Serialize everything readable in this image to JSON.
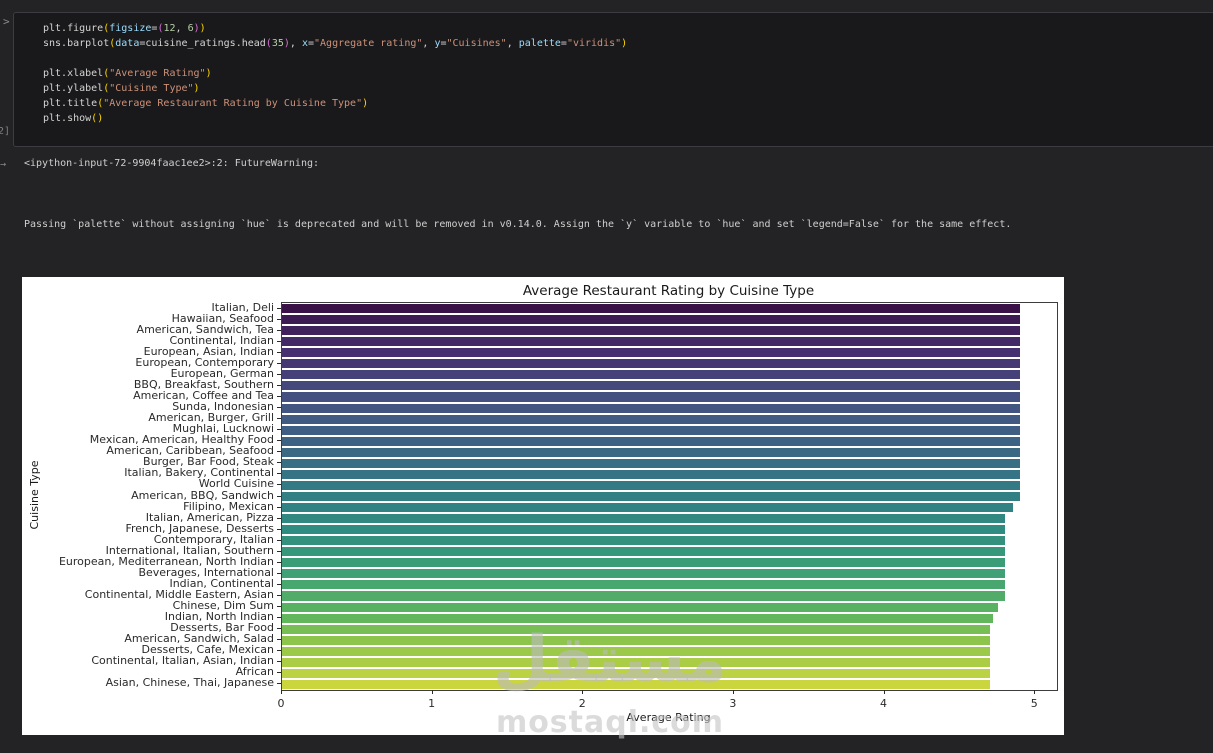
{
  "notebook": {
    "gutter": {
      "collapse_icon": ">",
      "execution_label": "2]",
      "output_marker_icon": "→"
    },
    "cell": {
      "token_colors": {
        "pl": "#d4d4d4",
        "kw": "#9cdcfe",
        "st": "#ce9178",
        "nu": "#b5cea8",
        "b1": "#ffd700",
        "b2": "#da70d6"
      },
      "code_lines": [
        [
          [
            "pl",
            "plt.figure"
          ],
          [
            "b1",
            "("
          ],
          [
            "kw",
            "figsize"
          ],
          [
            "pl",
            "="
          ],
          [
            "b2",
            "("
          ],
          [
            "nu",
            "12"
          ],
          [
            "pl",
            ", "
          ],
          [
            "nu",
            "6"
          ],
          [
            "b2",
            ")"
          ],
          [
            "b1",
            ")"
          ]
        ],
        [
          [
            "pl",
            "sns.barplot"
          ],
          [
            "b1",
            "("
          ],
          [
            "kw",
            "data"
          ],
          [
            "pl",
            "=cuisine_ratings.head"
          ],
          [
            "b2",
            "("
          ],
          [
            "nu",
            "35"
          ],
          [
            "b2",
            ")"
          ],
          [
            "pl",
            ", "
          ],
          [
            "kw",
            "x"
          ],
          [
            "pl",
            "="
          ],
          [
            "st",
            "\"Aggregate rating\""
          ],
          [
            "pl",
            ", "
          ],
          [
            "kw",
            "y"
          ],
          [
            "pl",
            "="
          ],
          [
            "st",
            "\"Cuisines\""
          ],
          [
            "pl",
            ", "
          ],
          [
            "kw",
            "palette"
          ],
          [
            "pl",
            "="
          ],
          [
            "st",
            "\"viridis\""
          ],
          [
            "b1",
            ")"
          ]
        ],
        [],
        [
          [
            "pl",
            "plt.xlabel"
          ],
          [
            "b1",
            "("
          ],
          [
            "st",
            "\"Average Rating\""
          ],
          [
            "b1",
            ")"
          ]
        ],
        [
          [
            "pl",
            "plt.ylabel"
          ],
          [
            "b1",
            "("
          ],
          [
            "st",
            "\"Cuisine Type\""
          ],
          [
            "b1",
            ")"
          ]
        ],
        [
          [
            "pl",
            "plt.title"
          ],
          [
            "b1",
            "("
          ],
          [
            "st",
            "\"Average Restaurant Rating by Cuisine Type\""
          ],
          [
            "b1",
            ")"
          ]
        ],
        [
          [
            "pl",
            "plt.show"
          ],
          [
            "b1",
            "("
          ],
          [
            "b1",
            ")"
          ]
        ]
      ]
    },
    "output": {
      "warning_location": "<ipython-input-72-9904faac1ee2>:2: FutureWarning:",
      "warning_message": "Passing `palette` without assigning `hue` is deprecated and will be removed in v0.14.0. Assign the `y` variable to `hue` and set `legend=False` for the same effect."
    }
  },
  "chart_data": {
    "type": "bar",
    "orientation": "horizontal",
    "title": "Average Restaurant Rating by Cuisine Type",
    "xlabel": "Average Rating",
    "ylabel": "Cuisine Type",
    "xlim": [
      0,
      5.145
    ],
    "x_ticks": [
      0,
      1,
      2,
      3,
      4,
      5
    ],
    "grid": false,
    "legend": false,
    "palette": "viridis",
    "categories": [
      "Italian, Deli",
      "Hawaiian, Seafood",
      "American, Sandwich, Tea",
      "Continental, Indian",
      "European, Asian, Indian",
      "European, Contemporary",
      "European, German",
      "BBQ, Breakfast, Southern",
      "American, Coffee and Tea",
      "Sunda, Indonesian",
      "American, Burger, Grill",
      "Mughlai, Lucknowi",
      "Mexican, American, Healthy Food",
      "American, Caribbean, Seafood",
      "Burger, Bar Food, Steak",
      "Italian, Bakery, Continental",
      "World Cuisine",
      "American, BBQ, Sandwich",
      "Filipino, Mexican",
      "Italian, American, Pizza",
      "French, Japanese, Desserts",
      "Contemporary, Italian",
      "International, Italian, Southern",
      "European, Mediterranean, North Indian",
      "Beverages, International",
      "Indian, Continental",
      "Continental, Middle Eastern, Asian",
      "Chinese, Dim Sum",
      "Indian, North Indian",
      "Desserts, Bar Food",
      "American, Sandwich, Salad",
      "Desserts, Cafe, Mexican",
      "Continental, Italian, Asian, Indian",
      "African",
      "Asian, Chinese, Thai, Japanese"
    ],
    "values": [
      4.9,
      4.9,
      4.9,
      4.9,
      4.9,
      4.9,
      4.9,
      4.9,
      4.9,
      4.9,
      4.9,
      4.9,
      4.9,
      4.9,
      4.9,
      4.9,
      4.9,
      4.9,
      4.85,
      4.8,
      4.8,
      4.8,
      4.8,
      4.8,
      4.8,
      4.8,
      4.8,
      4.75,
      4.72,
      4.7,
      4.7,
      4.7,
      4.7,
      4.7,
      4.7
    ],
    "bar_colors": [
      "#3a1247",
      "#3d1a51",
      "#40215b",
      "#432965",
      "#46306f",
      "#463873",
      "#454077",
      "#45487b",
      "#44507f",
      "#425580",
      "#415a82",
      "#3f5e83",
      "#3d6384",
      "#3b6984",
      "#386f85",
      "#367485",
      "#337a85",
      "#327f84",
      "#318383",
      "#308881",
      "#2f8c80",
      "#33917d",
      "#37977b",
      "#3b9c78",
      "#3fa175",
      "#48a76f",
      "#51ac69",
      "#59b262",
      "#62b75c",
      "#77be54",
      "#8cc44c",
      "#9cc949",
      "#abcd45",
      "#bbd242",
      "#cbd63f"
    ]
  },
  "watermark": {
    "logo_text": "مستقل",
    "site_text": "mostaql.com",
    "color": "#bcbcbc"
  }
}
